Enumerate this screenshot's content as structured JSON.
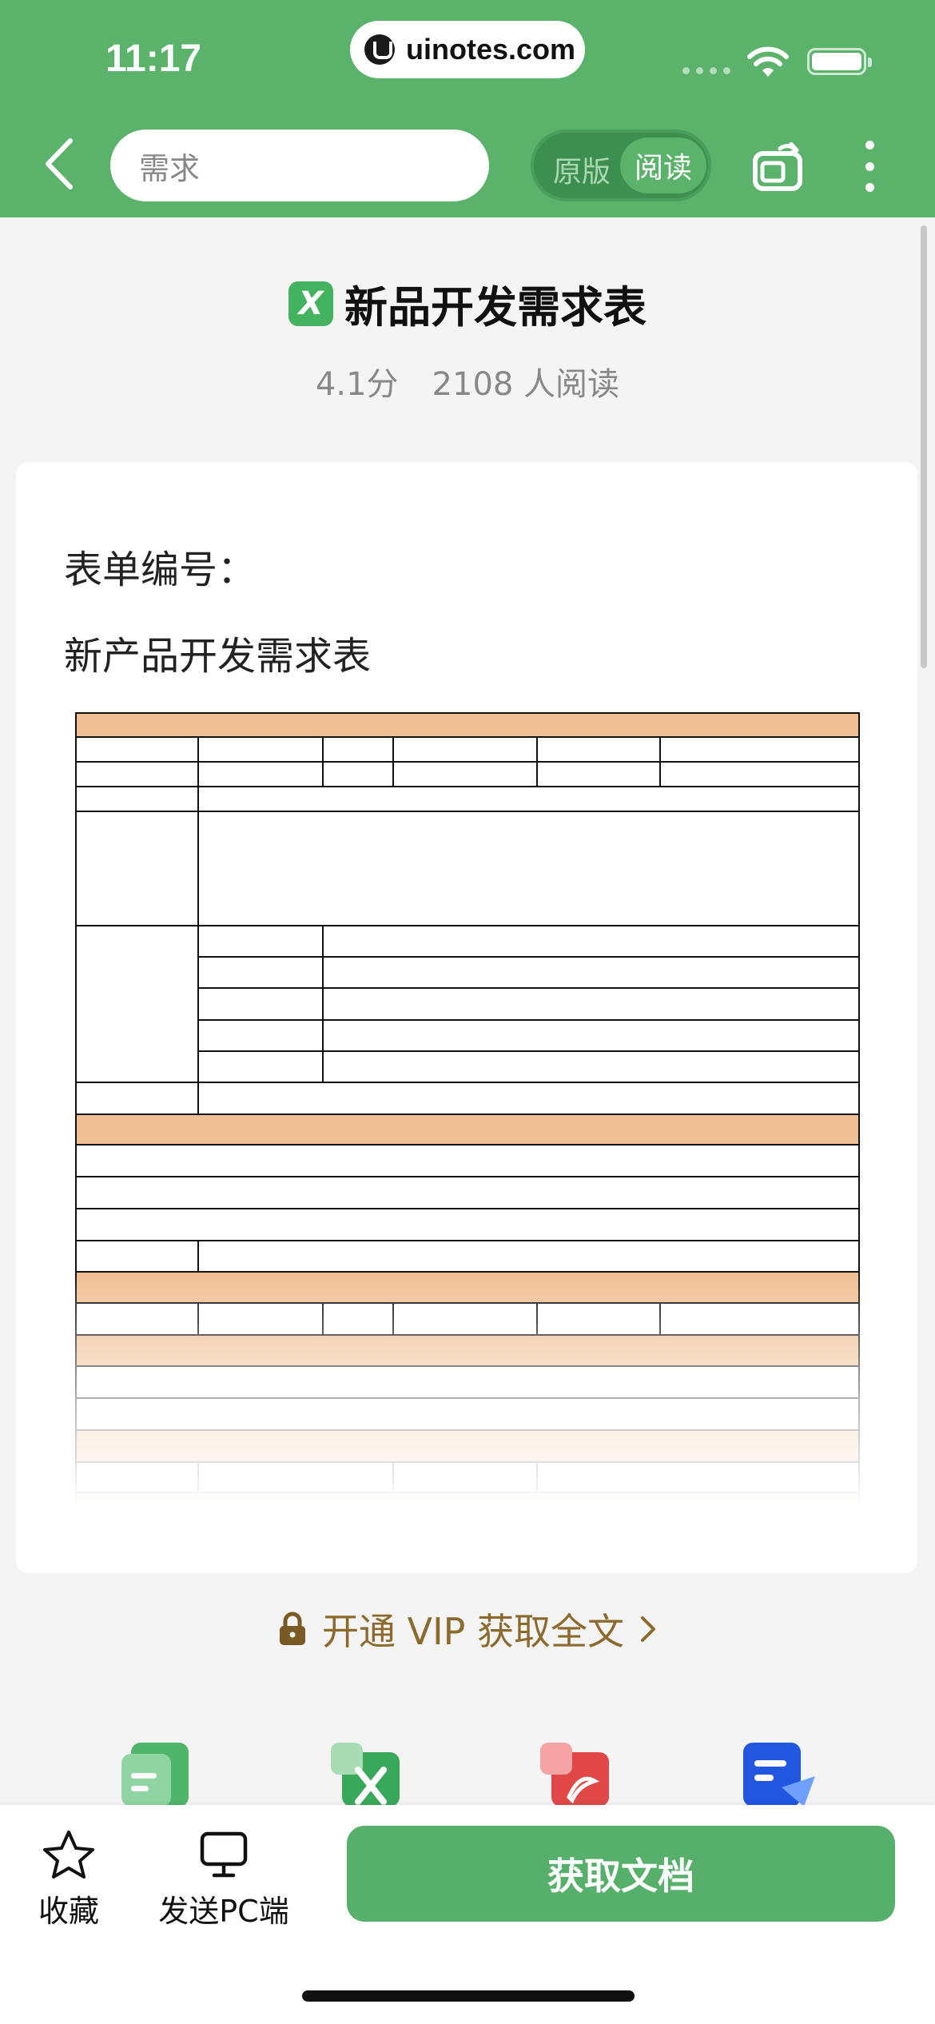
{
  "status": {
    "time": "11:17",
    "url": "uinotes.com"
  },
  "toolbar": {
    "search_value": "需求",
    "mode_original": "原版",
    "mode_reading": "阅读"
  },
  "document": {
    "title": "新品开发需求表",
    "file_type_badge": "X",
    "rating": "4.1分",
    "reads": "2108 人阅读",
    "form_number_label": "表单编号：",
    "form_heading": "新产品开发需求表"
  },
  "vip": {
    "label": "开通 VIP 获取全文"
  },
  "bottom": {
    "favorite_label": "收藏",
    "send_pc_label": "发送PC端",
    "get_doc_label": "获取文档"
  },
  "colors": {
    "brand_green": "#5bb26b",
    "header_row_orange": "#f0bf93",
    "vip_gold": "#8c6a2e"
  },
  "icons": [
    "back-chevron-icon",
    "rotate-screen-icon",
    "more-vertical-icon",
    "lock-icon",
    "chevron-right-icon",
    "star-icon",
    "monitor-icon"
  ]
}
